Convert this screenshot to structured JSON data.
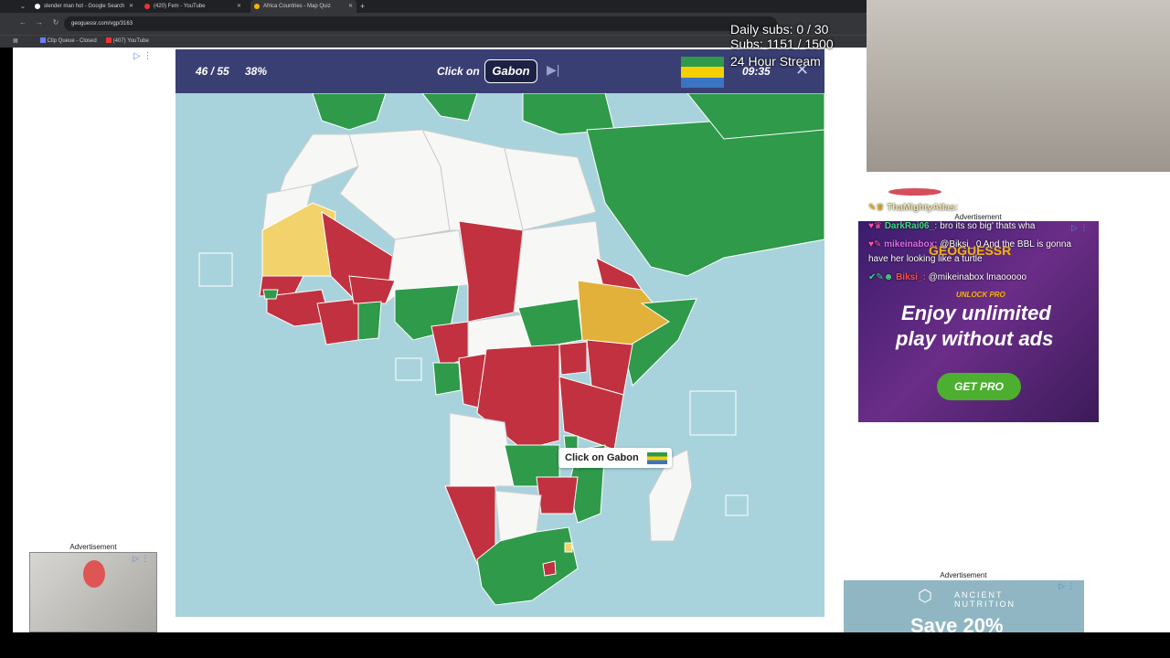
{
  "browser": {
    "tabs": [
      {
        "label": "slender man hot - Google Search"
      },
      {
        "label": "(420) Fem - YouTube"
      },
      {
        "label": "Africa Countries - Map Quiz"
      }
    ],
    "url": "geoguessr.com/vgp/3163",
    "bookmarks": [
      {
        "label": "Clip Queue - Closed"
      },
      {
        "label": "(407) YouTube"
      }
    ]
  },
  "game": {
    "progress": "46 / 55",
    "percent": "38%",
    "prompt": "Click on",
    "target": "Gabon",
    "timer": "09:35",
    "tooltip": "Click on Gabon"
  },
  "overlay": {
    "daily_subs": "Daily subs: 0 / 30",
    "subs": "Subs: 1151 / 1500",
    "stream": "24 Hour Stream"
  },
  "chat": [
    {
      "user": "ThaMightyAtlas:",
      "text": "",
      "color": "#f2e6a6"
    },
    {
      "user": "DarkRai06_:",
      "text": "bro its so big' thats wha",
      "color": "#3ddc84"
    },
    {
      "user": "mikeinabox:",
      "text": "@Biksi_ 0 And the BBL is gonna",
      "color": "#e06cf0"
    },
    {
      "user": "",
      "text": "have her looking like a turtle",
      "color": "#ffffff"
    },
    {
      "user": "Biksi_:",
      "text": "@mikeinabox lmaooooo",
      "color": "#ff4f4f"
    }
  ],
  "ads": {
    "label": "Advertisement",
    "pro_brand": "GEOGUESSR",
    "pro_kicker": "UNLOCK PRO",
    "pro_line1": "Enjoy unlimited",
    "pro_line2": "play without ads",
    "pro_button": "GET PRO",
    "right_brand_line1": "ANCIENT",
    "right_brand_line2": "NUTRITION",
    "right_promo": "Save 20%"
  },
  "colors": {
    "correct": "#2e9a4a",
    "wrong": "#c1313f",
    "unanswered": "#f7f7f5",
    "hint": "#f2d36b",
    "header": "#3a3f73",
    "ocean": "#a9d3dc"
  }
}
